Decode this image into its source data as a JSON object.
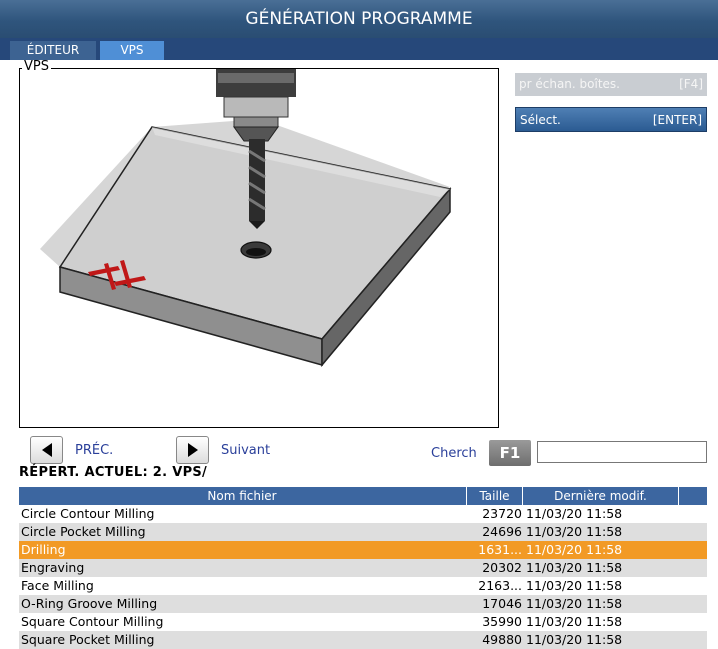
{
  "window": {
    "title": "GÉNÉRATION PROGRAMME"
  },
  "tabs": [
    {
      "label": "ÉDITEUR"
    },
    {
      "label": "VPS"
    }
  ],
  "preview": {
    "legend": "VPS"
  },
  "side_buttons": [
    {
      "label": "pr échan. boîtes.",
      "key": "[F4]"
    },
    {
      "label": "Sélect.",
      "key": "[ENTER]"
    }
  ],
  "nav": {
    "prev_label": "PRÉC.",
    "next_label": "Suivant"
  },
  "search": {
    "label": "Cherch",
    "key": "F1",
    "value": ""
  },
  "current_dir": "RÉPERT. ACTUEL: 2. VPS/",
  "table": {
    "headers": {
      "name": "Nom fichier",
      "size": "Taille",
      "modified": "Dernière modif."
    },
    "rows": [
      {
        "name": "Circle Contour Milling",
        "size": "23720",
        "modified": "11/03/20 11:58"
      },
      {
        "name": "Circle Pocket Milling",
        "size": "24696",
        "modified": "11/03/20 11:58"
      },
      {
        "name": "Drilling",
        "size": "1631...",
        "modified": "11/03/20 11:58"
      },
      {
        "name": "Engraving",
        "size": "20302",
        "modified": "11/03/20 11:58"
      },
      {
        "name": "Face Milling",
        "size": "2163...",
        "modified": "11/03/20 11:58"
      },
      {
        "name": "O-Ring Groove Milling",
        "size": "17046",
        "modified": "11/03/20 11:58"
      },
      {
        "name": "Square Contour Milling",
        "size": "35990",
        "modified": "11/03/20 11:58"
      },
      {
        "name": "Square Pocket Milling",
        "size": "49880",
        "modified": "11/03/20 11:58"
      }
    ],
    "selected_row": 2
  },
  "colors": {
    "selected_row": "#f29a25",
    "header": "#3c66a0",
    "title_bar": "#2f557d"
  }
}
